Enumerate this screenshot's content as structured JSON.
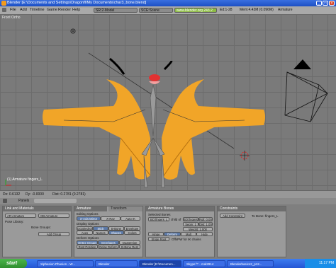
{
  "window": {
    "title": "Blender [E:\\Documents and Settings\\Dragonfl\\My Documents\\char3_bone.blend]"
  },
  "menu": [
    "File",
    "Add",
    "Timeline",
    "Game",
    "Render",
    "Help"
  ],
  "screen": "SR:2-Model",
  "scene": "SCE:Scene",
  "url": "www.blender.org 243.2",
  "stats": "Ed:1-28",
  "mem": "Mem:4.42M (0.096M)",
  "context": "Armature",
  "viewport": {
    "view_label": "Front Ortho",
    "object_label": "(1) Armature fingers_L",
    "status": {
      "dx": "Dx: 0.6132",
      "dy": "Dy: -0.0000",
      "dist": "Dist: 0.2781 (0.2781)"
    },
    "mode": "Edit Mode",
    "menus": [
      "View",
      "Select",
      "Armature"
    ]
  },
  "buttons_header": {
    "panels": "Panels"
  },
  "panels": {
    "link": {
      "title": "Link and Materials",
      "ar_label": "AR:Armature",
      "ob_label": "OB:Armature",
      "pose_library": "Pose Library:",
      "bone_groups": "Bone Groups:",
      "add_group": "Add Group"
    },
    "armature": {
      "tabs": [
        "Armature",
        "Transform"
      ],
      "editing_options": "Editing Options",
      "x_axis_mirror": "X-Axis Mirror",
      "x_ray": "X-Ray",
      "auto_ik": "Auto IK",
      "display_options": "Display Options",
      "display": [
        "Octahedron",
        "Stick",
        "B-Bone",
        "Envelope"
      ],
      "display2": [
        "Axes",
        "Names",
        "Shapes",
        "Colors"
      ],
      "deform_options": "Deform Options",
      "deform": [
        "Vertex Groups",
        "Envelopes",
        "Quaternion"
      ],
      "deform2": [
        "Rest Position",
        "Delay Deform",
        "B-Bone Rest"
      ]
    },
    "bones": {
      "title": "Armature Bones",
      "selected_bones": "Selected Bones",
      "bone_name": "BO:fingers_L",
      "child_of": "child of",
      "parent": "BO:fingers_L",
      "roll": "Roll: 0.000",
      "seg": "Segm: 1",
      "dist": "Dist: 1.000",
      "weight": "Weight: 1.000",
      "hinge": "Hinge",
      "deform": "Deform",
      "mult": "Mult",
      "hide": "Hide",
      "stride": "Stride Root",
      "offset": "OffsPW for IK chains"
    },
    "constraints": {
      "title": "Constraints",
      "add": "Add Constraint",
      "to_bone": "To Bone: fingers_L"
    }
  },
  "taskbar": {
    "start": "start",
    "tasks": [
      "Xiphesion Phusion - W...",
      "Blender",
      "Blender [E:\\Documen...",
      "Skype™ - mal2914",
      "Blenderbasics2_p12..."
    ],
    "time": "11:17 PM"
  }
}
